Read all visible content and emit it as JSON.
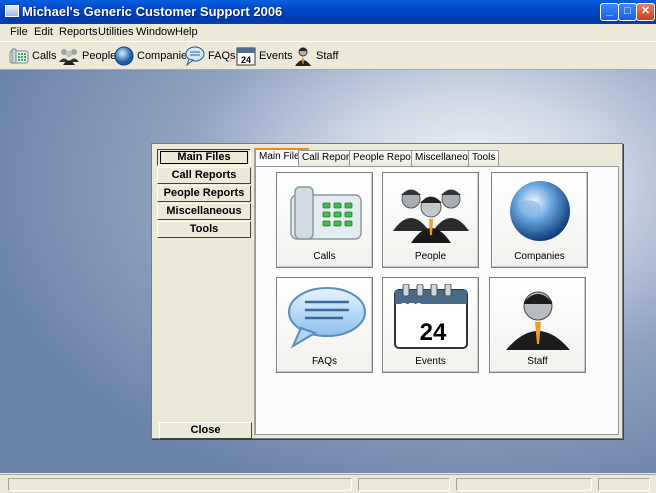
{
  "window": {
    "title": "Michael's Generic Customer Support 2006",
    "controls": [
      "minimize",
      "maximize",
      "close"
    ]
  },
  "menu": [
    {
      "label": "File"
    },
    {
      "label": "Edit"
    },
    {
      "label": "Reports"
    },
    {
      "label": "Utilities"
    },
    {
      "label": "Window"
    },
    {
      "label": "Help"
    }
  ],
  "toolbar": [
    {
      "label": "Calls",
      "icon": "calls-icon"
    },
    {
      "label": "People",
      "icon": "people-icon"
    },
    {
      "label": "Companies",
      "icon": "globe-icon"
    },
    {
      "label": "FAQs",
      "icon": "speech-bubble-icon"
    },
    {
      "label": "Events",
      "icon": "calendar-icon",
      "icon_text": "24"
    },
    {
      "label": "Staff",
      "icon": "staff-icon"
    }
  ],
  "left_nav": [
    {
      "label": "Main Files",
      "active": true
    },
    {
      "label": "Call Reports"
    },
    {
      "label": "People Reports"
    },
    {
      "label": "Miscellaneous"
    },
    {
      "label": "Tools"
    }
  ],
  "close_label": "Close",
  "tabs": [
    {
      "label": "Main Files",
      "active": true
    },
    {
      "label": "Call Reports"
    },
    {
      "label": "People Reports"
    },
    {
      "label": "Miscellaneous"
    },
    {
      "label": "Tools"
    }
  ],
  "tiles": [
    {
      "label": "Calls",
      "icon": "phone-icon"
    },
    {
      "label": "People",
      "icon": "people-icon"
    },
    {
      "label": "Companies",
      "icon": "globe-icon"
    },
    {
      "label": "FAQs",
      "icon": "speech-bubble-icon"
    },
    {
      "label": "Events",
      "icon": "calendar-icon",
      "calendar_month": "DEC",
      "calendar_day": "24"
    },
    {
      "label": "Staff",
      "icon": "staff-icon"
    }
  ],
  "colors": {
    "titlebar": "#0046c8",
    "tab_highlight": "#e68b2c",
    "mdi_background": "#8fa2c0"
  }
}
